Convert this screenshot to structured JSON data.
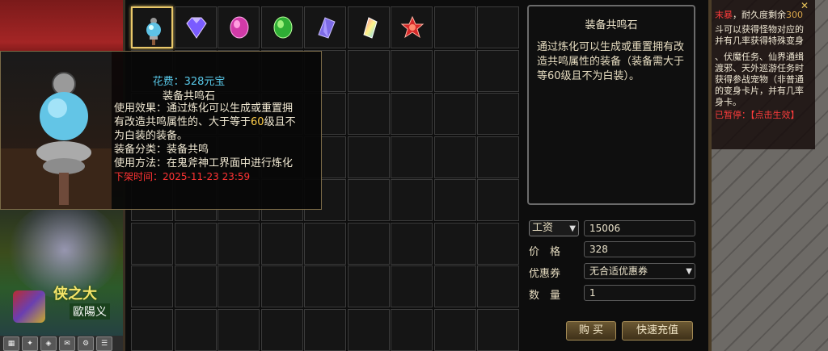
{
  "scene": {
    "npc_title": "侠之大",
    "npc_name": "歐陽义",
    "hotbar_icons": [
      "bag-icon",
      "skill-icon",
      "map-icon",
      "mail-icon",
      "settings-icon",
      "menu-icon"
    ]
  },
  "quest": {
    "line1_a": "末暴",
    "line1_b": "，耐久度剩余",
    "line1_c": "300",
    "line2": "斗可以获得怪物对应的并有几率获得特殊变身",
    "line3": "、伏魔任务、仙界通缉渡邪、天外巡游任务时获得参战宠物（非普通的变身卡片，并有几率身卡。",
    "status_label": "已暂停：",
    "status_action": "【点击生效】"
  },
  "shop": {
    "items": [
      {
        "name": "equip-resonance-stone",
        "icon": "resonance-stone-icon",
        "selected": true
      },
      {
        "name": "blue-purple-diamond",
        "icon": "diamond-icon"
      },
      {
        "name": "pink-gem",
        "icon": "pink-gem-icon"
      },
      {
        "name": "green-gem",
        "icon": "green-gem-icon"
      },
      {
        "name": "purple-crystal",
        "icon": "purple-crystal-icon"
      },
      {
        "name": "rainbow-crystal",
        "icon": "rainbow-crystal-icon"
      },
      {
        "name": "red-star-stone",
        "icon": "red-star-icon"
      }
    ]
  },
  "detail": {
    "title": "装备共鸣石",
    "description": "通过炼化可以生成或重置拥有改造共鸣属性的装备（装备需大于等60级且不为白装）。"
  },
  "form": {
    "currency_type": "工资",
    "currency_value": "15006",
    "price_label": "价　格",
    "price_value": "328",
    "coupon_label": "优惠券",
    "coupon_value": "无合适优惠券",
    "qty_label": "数　量",
    "qty_value": "1",
    "buy_label": "购 买",
    "recharge_label": "快速充值"
  },
  "tooltip": {
    "cost_label": "花费：",
    "cost_amount": "328",
    "cost_unit": "元宝",
    "name": "装备共鸣石",
    "effect_label": "使用效果：",
    "effect_line1": "通过炼化可以生成或重置拥",
    "effect_line2_a": "有改造共鸣属性的、大于等于",
    "effect_line2_level": "60",
    "effect_line2_b": "级且不",
    "effect_line3": "为白装的装备。",
    "category_label": "装备分类：",
    "category_value": "装备共鸣",
    "method_label": "使用方法：",
    "method_value": "在鬼斧神工界面中进行炼化",
    "expire_label": "下架时间：",
    "expire_value": "2025-11-23 23:59"
  },
  "colors": {
    "gold_border": "#e9c86a",
    "cost_cyan": "#58c8e8",
    "level_yellow": "#ffcf4a",
    "expire_red": "#ff3333"
  }
}
